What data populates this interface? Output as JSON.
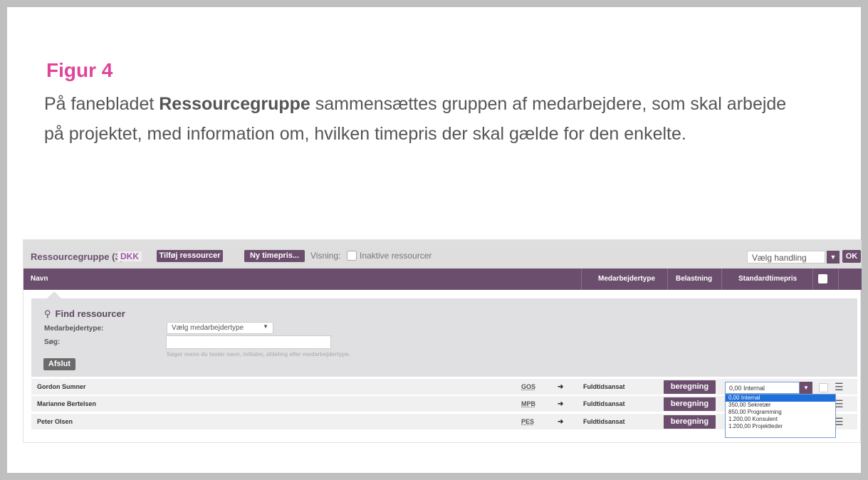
{
  "figure": {
    "title": "Figur 4",
    "text_before": "På fanebladet ",
    "text_bold": "Ressourcegruppe",
    "text_after": " sammensættes gruppen af medarbejdere, som skal arbejde på projektet, med information om, hvilken timepris der skal gælde for den enkelte."
  },
  "toolbar": {
    "title": "Ressourcegruppe (3)",
    "currency": "DKK",
    "add_button": "Tilføj ressourcer",
    "new_rate_button": "Ny timepris...",
    "view_label": "Visning:",
    "inactive_label": "Inaktive ressourcer",
    "action_select": "Vælg handling",
    "ok_button": "OK"
  },
  "table": {
    "headers": [
      "Navn",
      "Medarbejdertype",
      "Belastning",
      "Standardtimepris"
    ]
  },
  "find": {
    "title": "Find ressourcer",
    "type_label": "Medarbejdertype:",
    "type_select": "Vælg medarbejdertype",
    "search_label": "Søg:",
    "search_value": "",
    "hint": "Søger mens du taster navn, initialer, afdeling eller medarbejdertype.",
    "close_button": "Afslut"
  },
  "rows": [
    {
      "name": "Gordon Sumner",
      "initials": "GOS",
      "arrow": "➜",
      "type": "Fuldtidsansat",
      "button": "beregning"
    },
    {
      "name": "Marianne Bertelsen",
      "initials": "MPB",
      "arrow": "➜",
      "type": "Fuldtidsansat",
      "button": "beregning"
    },
    {
      "name": "Peter Olsen",
      "initials": "PES",
      "arrow": "➜",
      "type": "Fuldtidsansat",
      "button": "beregning"
    }
  ],
  "rate_dropdown": {
    "selected": "0,00 Internal",
    "options": [
      "0,00 Internal",
      "350,00 Sekretær",
      "850,00 Programming",
      "1.200,00 Konsulent",
      "1.200,00 Projektleder"
    ]
  },
  "colors": {
    "accent": "#6b4e6d",
    "figure_title": "#e0449a"
  }
}
